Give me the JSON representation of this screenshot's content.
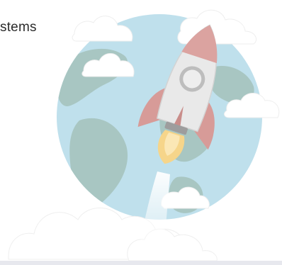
{
  "heading": {
    "text": "stems"
  },
  "illustration": {
    "globe_icon": "globe-icon",
    "rocket_icon": "rocket-icon",
    "cloud_icon": "cloud-icon",
    "smoke_icon": "smoke-cloud-icon"
  },
  "colors": {
    "ocean": "#bfe0ec",
    "land": "#a8c6c2",
    "rocket_body": "#e9e9e9",
    "rocket_fin": "#d79b98",
    "flame": "#f6d58a",
    "cloud": "#ffffff"
  }
}
